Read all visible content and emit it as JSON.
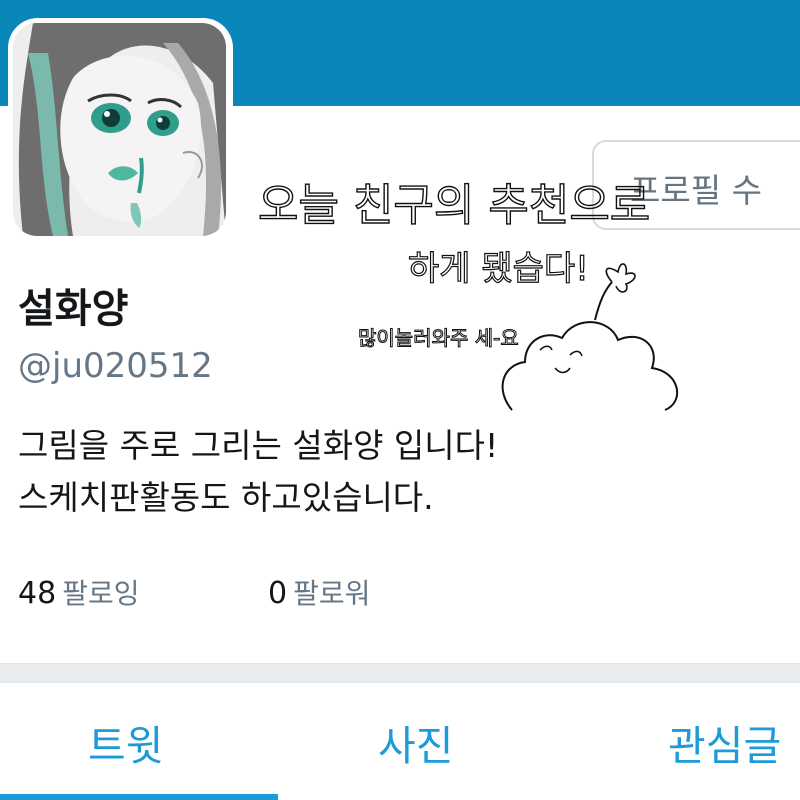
{
  "profile": {
    "display_name": "설화양",
    "handle": "@ju020512",
    "bio_lines": [
      "그림을 주로 그리는 설화양 입니다!",
      "스케치판활동도 하고있습니다."
    ],
    "edit_button_label": "프로필 수"
  },
  "stats": {
    "following_count": "48",
    "following_label": "팔로잉",
    "followers_count": "0",
    "followers_label": "팔로워"
  },
  "tabs": [
    {
      "label": "트윗",
      "active": true
    },
    {
      "label": "사진",
      "active": false
    },
    {
      "label": "관심글",
      "active": false
    }
  ],
  "handwriting": {
    "line1": "오늘 친구의 추천으로",
    "line2": "하게 됐습다!",
    "line3": "많이놀러와주 세-요"
  },
  "colors": {
    "banner": "#0a86b9",
    "accent": "#1d9bd8",
    "muted_text": "#657786"
  }
}
